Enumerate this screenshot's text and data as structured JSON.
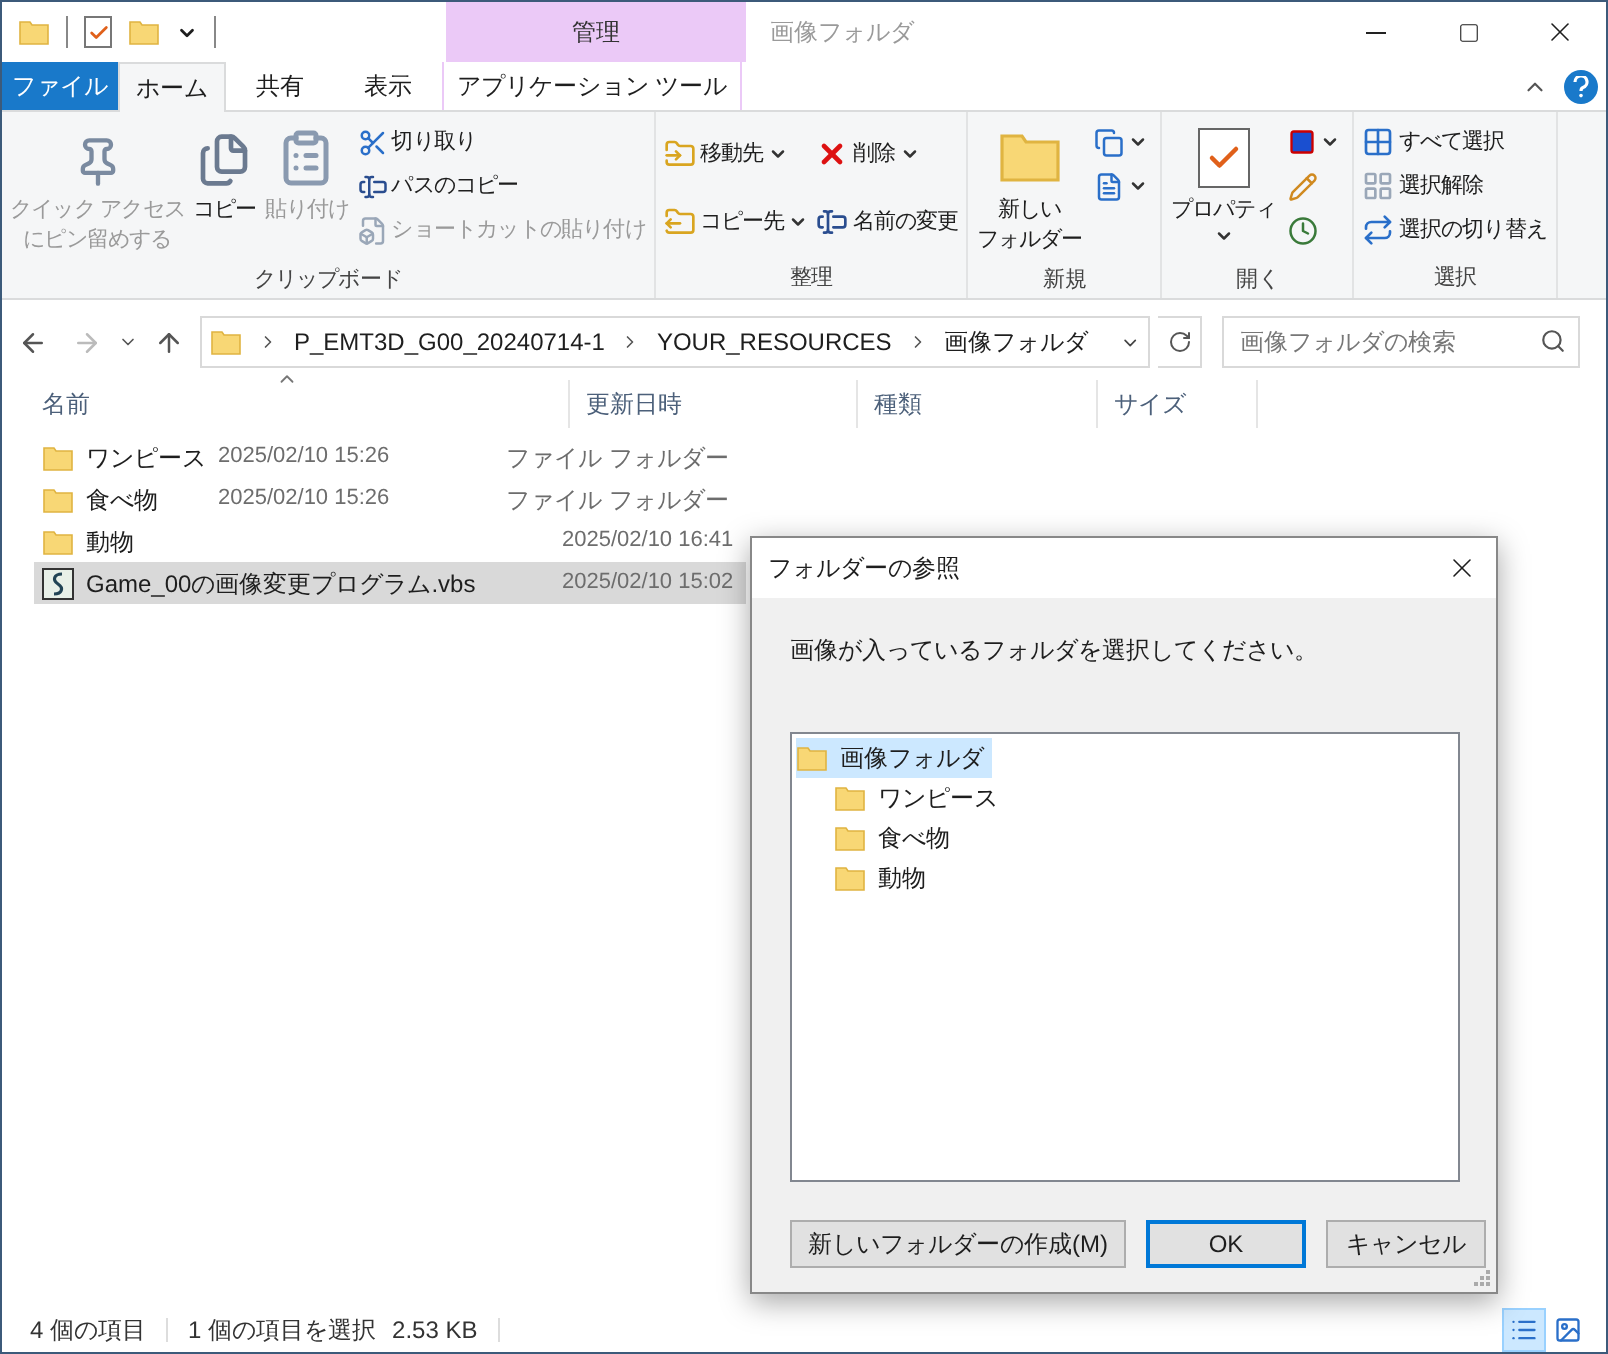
{
  "window": {
    "title": "画像フォルダ",
    "context_header": "管理"
  },
  "tabs": [
    {
      "label": "ファイル",
      "kind": "file",
      "selected": false
    },
    {
      "label": "ホーム",
      "kind": "tab",
      "selected": true
    },
    {
      "label": "共有",
      "kind": "tab",
      "selected": false
    },
    {
      "label": "表示",
      "kind": "tab",
      "selected": false
    },
    {
      "label": "アプリケーション ツール",
      "kind": "context",
      "selected": false
    }
  ],
  "ribbon": [
    {
      "title": "クリップボード",
      "columns": [
        [
          {
            "lines": [
              "クイック アクセス",
              "にピン留めする"
            ],
            "kind": "large",
            "disabled": true,
            "dropdown": false
          }
        ],
        [
          {
            "lines": [
              "コピー"
            ],
            "kind": "large",
            "disabled": false,
            "dropdown": false
          }
        ],
        [
          {
            "lines": [
              "貼り付け"
            ],
            "kind": "large",
            "disabled": true,
            "dropdown": false
          }
        ],
        [
          {
            "label": "切り取り",
            "kind": "small",
            "disabled": false,
            "dropdown": false
          },
          {
            "label": "パスのコピー",
            "kind": "small",
            "disabled": false,
            "dropdown": false
          },
          {
            "label": "ショートカットの貼り付け",
            "kind": "small",
            "disabled": true,
            "dropdown": false
          }
        ]
      ]
    },
    {
      "title": "整理",
      "columns": [
        [
          {
            "label": "移動先",
            "kind": "small",
            "disabled": false,
            "dropdown": true
          },
          {
            "label": "コピー先",
            "kind": "small",
            "disabled": false,
            "dropdown": true
          }
        ],
        [
          {
            "label": "削除",
            "kind": "small",
            "disabled": false,
            "dropdown": true
          },
          {
            "label": "名前の変更",
            "kind": "small",
            "disabled": false,
            "dropdown": false
          }
        ]
      ]
    },
    {
      "title": "新規",
      "columns": [
        [
          {
            "lines": [
              "新しい",
              "フォルダー"
            ],
            "kind": "large",
            "disabled": false,
            "dropdown": false
          }
        ],
        [
          {
            "kind": "icon",
            "disabled": false,
            "dropdown": true
          },
          {
            "kind": "icon",
            "disabled": false,
            "dropdown": true
          }
        ]
      ]
    },
    {
      "title": "開く",
      "columns": [
        [
          {
            "lines": [
              "プロパティ"
            ],
            "kind": "large",
            "disabled": false,
            "dropdown": true
          }
        ],
        [
          {
            "kind": "icon",
            "disabled": false,
            "dropdown": true
          },
          {
            "kind": "icon",
            "disabled": false,
            "dropdown": false
          },
          {
            "kind": "icon",
            "disabled": false,
            "dropdown": false
          }
        ]
      ]
    },
    {
      "title": "選択",
      "columns": [
        [
          {
            "label": "すべて選択",
            "kind": "small",
            "disabled": false,
            "dropdown": false
          },
          {
            "label": "選択解除",
            "kind": "small",
            "disabled": false,
            "dropdown": false
          },
          {
            "label": "選択の切り替え",
            "kind": "small",
            "disabled": false,
            "dropdown": false
          }
        ]
      ]
    }
  ],
  "address": {
    "path": [
      "P_EMT3D_G00_20240714-1",
      "YOUR_RESOURCES",
      "画像フォルダ"
    ],
    "search_placeholder": "画像フォルダの検索"
  },
  "table": {
    "columns": [
      "名前",
      "更新日時",
      "種類",
      "サイズ"
    ],
    "rows": [
      {
        "kind": "folder",
        "name": "ワンピース",
        "date": "2025/02/10 15:26",
        "type": "ファイル フォルダー",
        "selected": false
      },
      {
        "kind": "folder",
        "name": "食べ物",
        "date": "2025/02/10 15:26",
        "type": "ファイル フォルダー",
        "selected": false
      },
      {
        "kind": "folder",
        "name": "動物",
        "date": "2025/02/10 16:41",
        "type": "",
        "selected": false
      },
      {
        "kind": "script",
        "name": "Game_00の画像変更プログラム.vbs",
        "date": "2025/02/10 15:02",
        "type": "",
        "selected": true
      }
    ]
  },
  "status_bar": {
    "count": "4 個の項目",
    "selection": "1 個の項目を選択",
    "size": "2.53 KB",
    "views": [
      {
        "kind": "details",
        "selected": true
      },
      {
        "kind": "large",
        "selected": false
      }
    ]
  },
  "dialog": {
    "title": "フォルダーの参照",
    "message": "画像が入っているフォルダを選択してください。",
    "tree": {
      "label": "画像フォルダ",
      "selected": true,
      "children": [
        {
          "label": "ワンピース",
          "selected": false
        },
        {
          "label": "食べ物",
          "selected": false
        },
        {
          "label": "動物",
          "selected": false
        }
      ]
    },
    "buttons": [
      {
        "label": "新しいフォルダーの作成(M)",
        "default": false
      },
      {
        "label": "OK",
        "default": true
      },
      {
        "label": "キャンセル",
        "default": false
      }
    ]
  }
}
